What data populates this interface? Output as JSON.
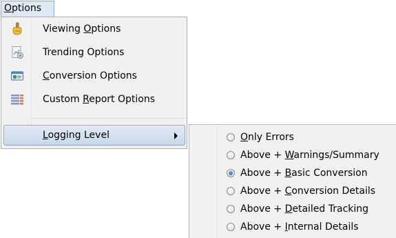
{
  "menubar": {
    "options_label": "Options",
    "options_label_pre": "",
    "options_label_key": "O",
    "options_label_post": "ptions"
  },
  "dropdown": {
    "items": [
      {
        "label": "Viewing Options",
        "pre": "Viewing ",
        "key": "O",
        "post": "ptions",
        "icon": "viewing-options-icon"
      },
      {
        "label": "Trending Options",
        "pre": "Trending Options",
        "key": "",
        "post": "",
        "icon": "trending-options-icon"
      },
      {
        "label": "Conversion Options",
        "pre": "",
        "key": "C",
        "post": "onversion Options",
        "icon": "conversion-options-icon"
      },
      {
        "label": "Custom Report Options",
        "pre": "Custom ",
        "key": "R",
        "post": "eport Options",
        "icon": "custom-report-options-icon"
      },
      {
        "label": "Logging Level",
        "pre": "",
        "key": "L",
        "post": "ogging Level",
        "has_submenu": true
      }
    ]
  },
  "logging_level": {
    "selected": "Above + Basic Conversion",
    "options": [
      {
        "label": "Only Errors",
        "pre": "",
        "key": "O",
        "post": "nly Errors",
        "selected": false
      },
      {
        "label": "Above + Warnings/Summary",
        "pre": "Above + ",
        "key": "W",
        "post": "arnings/Summary",
        "selected": false
      },
      {
        "label": "Above + Basic Conversion",
        "pre": "Above + ",
        "key": "B",
        "post": "asic Conversion",
        "selected": true
      },
      {
        "label": "Above + Conversion Details",
        "pre": "Above + ",
        "key": "C",
        "post": "onversion Details",
        "selected": false
      },
      {
        "label": "Above + Detailed Tracking",
        "pre": "Above + ",
        "key": "D",
        "post": "etailed Tracking",
        "selected": false
      },
      {
        "label": "Above + Internal Details",
        "pre": "Above + ",
        "key": "I",
        "post": "nternal Details",
        "selected": false
      }
    ]
  },
  "colors": {
    "menu_background": "#f1f1f1",
    "highlight_border": "#8fa9c8",
    "radio_selected": "#1c5ea8"
  }
}
